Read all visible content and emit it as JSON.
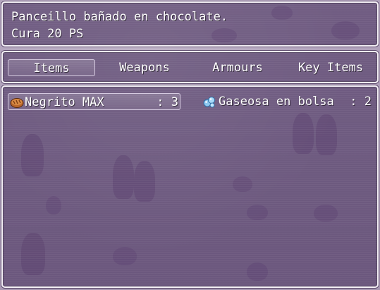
{
  "help": {
    "line1": "Panceillo bañado en chocolate.",
    "line2": "Cura 20 PS"
  },
  "categories": [
    {
      "label": "Items",
      "selected": true
    },
    {
      "label": "Weapons",
      "selected": false
    },
    {
      "label": "Armours",
      "selected": false
    },
    {
      "label": "Key Items",
      "selected": false
    }
  ],
  "items": [
    {
      "name": "Negrito MAX",
      "count": ": 3",
      "icon": "bread-icon",
      "selected": true
    },
    {
      "name": "Gaseosa en bolsa",
      "count": ": 2",
      "icon": "water-bag-icon",
      "selected": false
    }
  ],
  "colors": {
    "window_bg": "#3a2252",
    "border": "#f4f0f6",
    "text": "#ffffff"
  }
}
